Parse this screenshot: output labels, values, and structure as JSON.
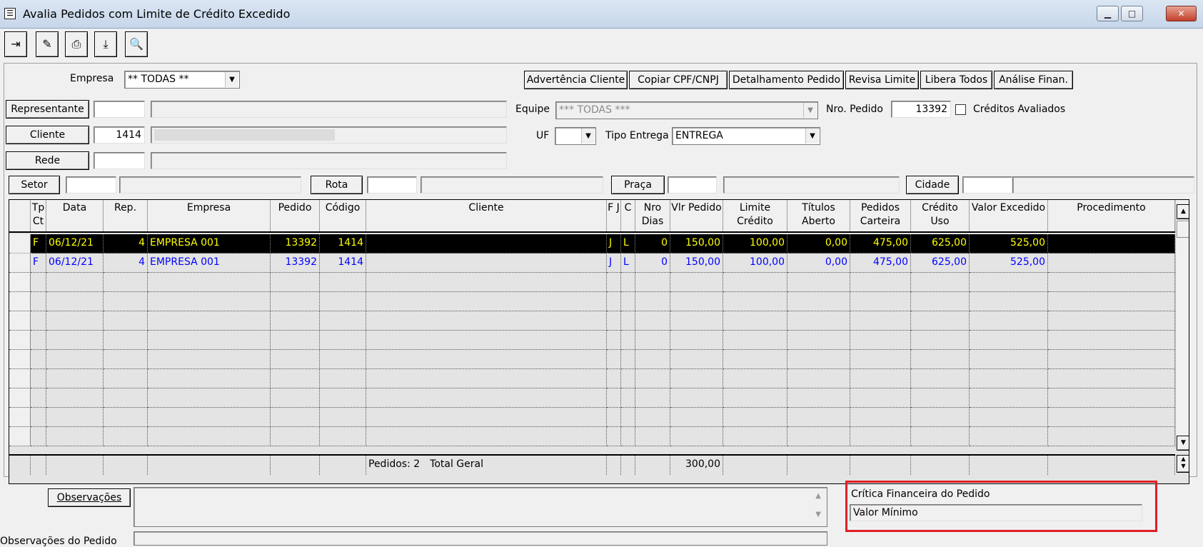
{
  "window": {
    "title": "Avalia Pedidos com Limite de Crédito Excedido",
    "minimize": "▁",
    "maximize": "□",
    "close": "✕",
    "system_icon": "form-icon"
  },
  "toolbar": {
    "exit": "⇥",
    "clear": "✎",
    "print": "⎙",
    "export": "⤓",
    "find": "🔍"
  },
  "filters": {
    "empresa_label": "Empresa",
    "empresa_value": "** TODAS **",
    "representante_button": "Representante",
    "representante_code": "",
    "cliente_button": "Cliente",
    "cliente_code": "1414",
    "rede_button": "Rede",
    "equipe_label": "Equipe",
    "equipe_value": "*** TODAS ***",
    "uf_label": "UF",
    "uf_value": "",
    "tipo_entrega_label": "Tipo Entrega",
    "tipo_entrega_value": "ENTREGA",
    "nro_pedido_label": "Nro. Pedido",
    "nro_pedido_value": "13392",
    "creditos_avaliados_label": "Créditos Avaliados",
    "setor_button": "Setor",
    "rota_button": "Rota",
    "praca_button": "Praça",
    "cidade_button": "Cidade"
  },
  "actions": {
    "advertencia": "Advertência Cliente",
    "copiar": "Copiar CPF/CNPJ",
    "detalhamento": "Detalhamento Pedido",
    "revisa": "Revisa Limite",
    "libera": "Libera Todos",
    "analise": "Análise Finan."
  },
  "grid": {
    "columns": [
      "Tp Ct",
      "Data",
      "Rep.",
      "Empresa",
      "Pedido",
      "Código",
      "Cliente",
      "F J",
      "C",
      "Nro Dias",
      "Vlr Pedido",
      "Limite Crédito",
      "Títulos Aberto",
      "Pedidos Carteira",
      "Crédito Uso",
      "Valor Excedido",
      "Procedimento"
    ],
    "rows": [
      {
        "tp": "F",
        "data": "06/12/21",
        "rep": "4",
        "empresa": "EMPRESA 001",
        "pedido": "13392",
        "codigo": "1414",
        "cliente": "",
        "fj": "J",
        "c": "L",
        "nro_dias": "0",
        "vlr_pedido": "150,00",
        "limite": "100,00",
        "titulos": "0,00",
        "carteira": "475,00",
        "credito_uso": "625,00",
        "excedido": "525,00",
        "procedimento": ""
      },
      {
        "tp": "F",
        "data": "06/12/21",
        "rep": "4",
        "empresa": "EMPRESA 001",
        "pedido": "13392",
        "codigo": "1414",
        "cliente": "",
        "fj": "J",
        "c": "L",
        "nro_dias": "0",
        "vlr_pedido": "150,00",
        "limite": "100,00",
        "titulos": "0,00",
        "carteira": "475,00",
        "credito_uso": "625,00",
        "excedido": "525,00",
        "procedimento": ""
      }
    ],
    "footer": {
      "pedidos": "Pedidos: 2",
      "total_label": "Total Geral",
      "total_value": "300,00"
    },
    "selected_color": "#000000",
    "selected_text_color": "#ffff00",
    "row_text_color": "#0000ff"
  },
  "bottom": {
    "observacoes_button": "Observações",
    "observacoes_pedido_label": "Observações do Pedido",
    "critica_label": "Crítica Financeira do Pedido",
    "critica_value": "Valor Mínimo",
    "highlight_color": "#e01e25"
  }
}
